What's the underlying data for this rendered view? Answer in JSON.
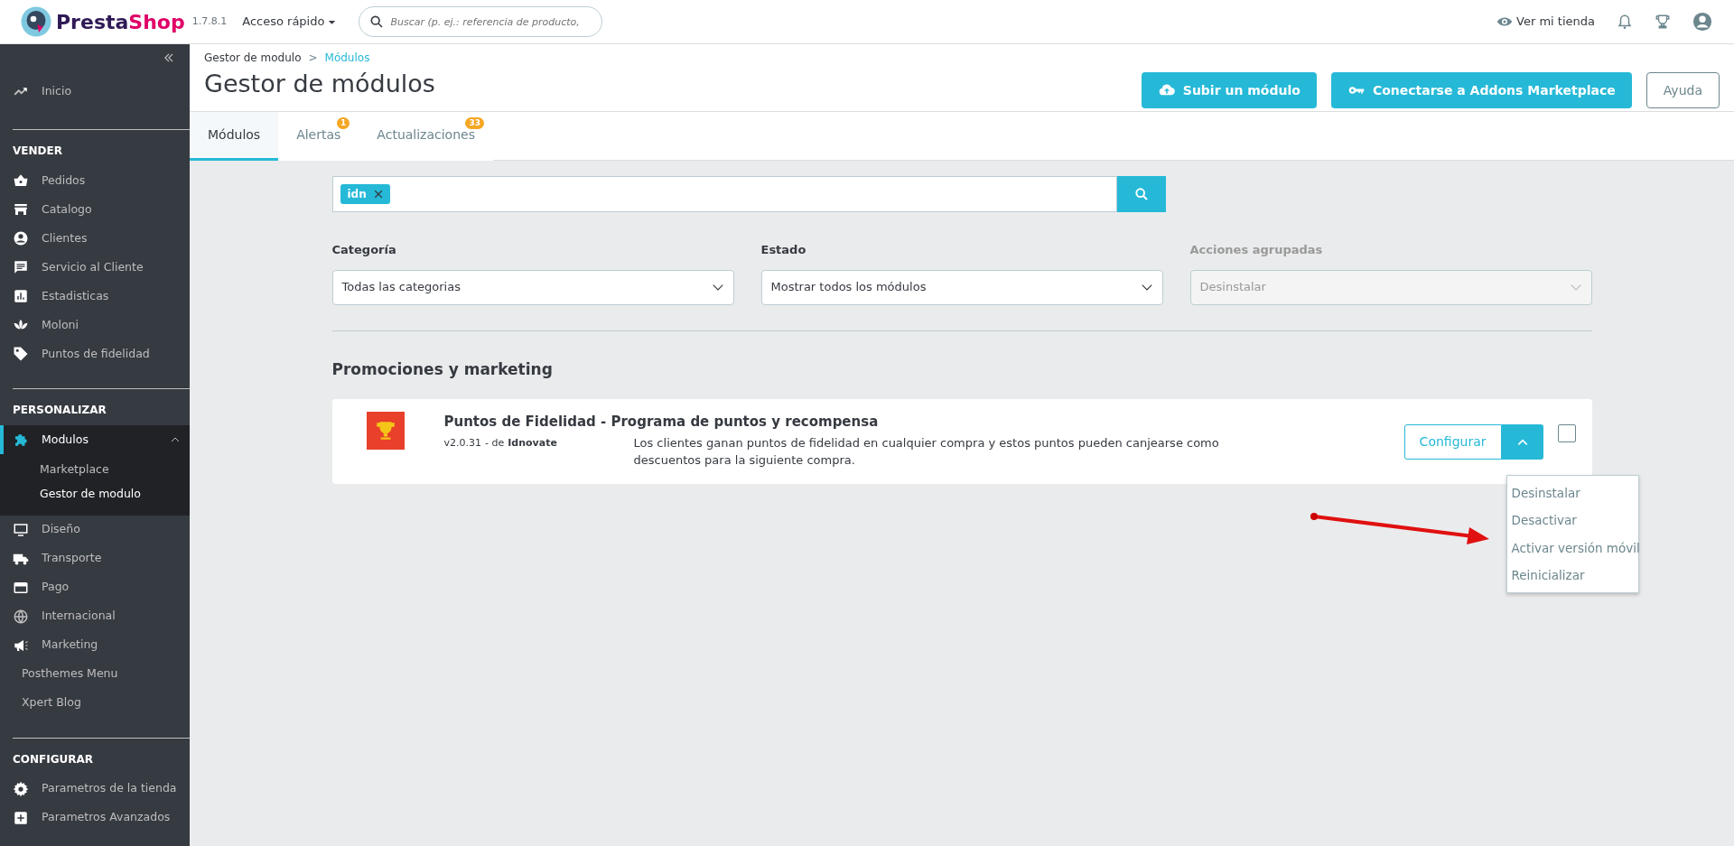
{
  "topbar": {
    "brand": [
      "Presta",
      "Shop"
    ],
    "version": "1.7.8.1",
    "quick_access": "Acceso rápido",
    "search": {
      "placeholder": "Buscar (p. ej.: referencia de producto,"
    },
    "view_store": "Ver mi tienda"
  },
  "sidebar": {
    "top_items": [
      {
        "label": "Inicio",
        "kind": "icon",
        "selected": false
      }
    ],
    "sections": [
      {
        "title": "VENDER",
        "items": [
          {
            "label": "Pedidos",
            "kind": "icon",
            "selected": false
          },
          {
            "label": "Catalogo",
            "kind": "icon",
            "selected": false
          },
          {
            "label": "Clientes",
            "kind": "icon",
            "selected": false
          },
          {
            "label": "Servicio al Cliente",
            "kind": "icon",
            "selected": false
          },
          {
            "label": "Estadisticas",
            "kind": "icon",
            "selected": false
          },
          {
            "label": "Moloni",
            "kind": "icon",
            "selected": false
          },
          {
            "label": "Puntos de fidelidad",
            "kind": "icon",
            "selected": false
          }
        ]
      },
      {
        "title": "PERSONALIZAR",
        "items": [
          {
            "label": "Modulos",
            "kind": "icon",
            "selected": true,
            "expanded": true,
            "children": [
              {
                "label": "Marketplace",
                "selected": false
              },
              {
                "label": "Gestor de modulo",
                "selected": true
              }
            ]
          },
          {
            "label": "Diseño",
            "kind": "icon",
            "selected": false
          },
          {
            "label": "Transporte",
            "kind": "icon",
            "selected": false
          },
          {
            "label": "Pago",
            "kind": "icon",
            "selected": false
          },
          {
            "label": "Internacional",
            "kind": "icon",
            "selected": false
          },
          {
            "label": "Marketing",
            "kind": "icon",
            "selected": false
          },
          {
            "label": "Posthemes Menu",
            "kind": "plain",
            "selected": false
          },
          {
            "label": "Xpert Blog",
            "kind": "plain",
            "selected": false
          }
        ]
      },
      {
        "title": "CONFIGURAR",
        "items": [
          {
            "label": "Parametros de la tienda",
            "kind": "icon",
            "selected": false
          },
          {
            "label": "Parametros Avanzados",
            "kind": "icon",
            "selected": false
          }
        ]
      }
    ]
  },
  "header": {
    "breadcrumb": [
      "Gestor de modulo",
      "Módulos"
    ],
    "separator": ">",
    "title": "Gestor de módulos",
    "buttons": [
      {
        "label": "Subir un módulo",
        "kind": "primary"
      },
      {
        "label": "Conectarse a Addons Marketplace",
        "kind": "primary"
      },
      {
        "label": "Ayuda",
        "kind": "outline"
      }
    ]
  },
  "tabs": [
    {
      "label": "Módulos",
      "selected": true
    },
    {
      "label": "Alertas",
      "selected": false,
      "badge": "1"
    },
    {
      "label": "Actualizaciones",
      "selected": false,
      "badge": "33"
    }
  ],
  "filter": {
    "tag": "idn",
    "filters": [
      {
        "label": "Categoría",
        "value": "Todas las categorias",
        "disabled": false
      },
      {
        "label": "Estado",
        "value": "Mostrar todos los módulos",
        "disabled": false
      },
      {
        "label": "Acciones agrupadas",
        "value": "Desinstalar",
        "disabled": true
      }
    ]
  },
  "section_title": "Promociones y marketing",
  "module": {
    "name": "Puntos de Fidelidad - Programa de puntos y recompensa",
    "version": "v2.0.31",
    "by": "- de",
    "author": "Idnovate",
    "description": "Los clientes ganan puntos de fidelidad en cualquier compra y estos puntos pueden canjearse como descuentos para la siguiente compra.",
    "configure": "Configurar",
    "checked": false,
    "expanded": true,
    "menu": [
      "Desinstalar",
      "Desactivar",
      "Activar versión móvil",
      "Reinicializar"
    ]
  }
}
